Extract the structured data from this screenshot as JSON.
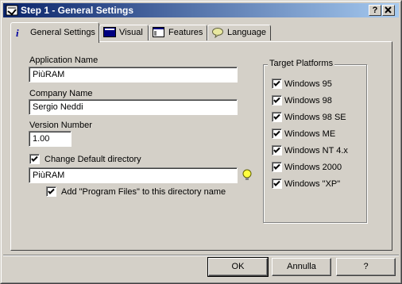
{
  "window": {
    "title": "Step 1 - General Settings",
    "help_btn": "?",
    "close_btn": "x"
  },
  "tabs": [
    {
      "label": "General Settings",
      "icon": "info-icon"
    },
    {
      "label": "Visual",
      "icon": "monitor-icon"
    },
    {
      "label": "Features",
      "icon": "window-icon"
    },
    {
      "label": "Language",
      "icon": "speech-bubble-icon"
    }
  ],
  "form": {
    "app_name_label": "Application Name",
    "app_name_value": "PiùRAM",
    "company_label": "Company Name",
    "company_value": "Sergio Neddi",
    "version_label": "Version Number",
    "version_value": "1.00",
    "change_dir_label": "Change Default directory",
    "change_dir_checked": true,
    "directory_value": "PiùRAM",
    "add_program_files_label": "Add \"Program Files\" to this directory name",
    "add_program_files_checked": true
  },
  "platforms": {
    "title": "Target Platforms",
    "items": [
      {
        "label": "Windows 95",
        "checked": true
      },
      {
        "label": "Windows 98",
        "checked": true
      },
      {
        "label": "Windows 98 SE",
        "checked": true
      },
      {
        "label": "Windows ME",
        "checked": true
      },
      {
        "label": "Windows NT 4.x",
        "checked": true
      },
      {
        "label": "Windows 2000",
        "checked": true
      },
      {
        "label": "Windows \"XP\"",
        "checked": true
      }
    ]
  },
  "buttons": {
    "ok": "OK",
    "cancel": "Annulla",
    "help": "?"
  },
  "colors": {
    "title_start": "#0a246a",
    "title_end": "#a6caf0",
    "face": "#d4d0c8"
  }
}
